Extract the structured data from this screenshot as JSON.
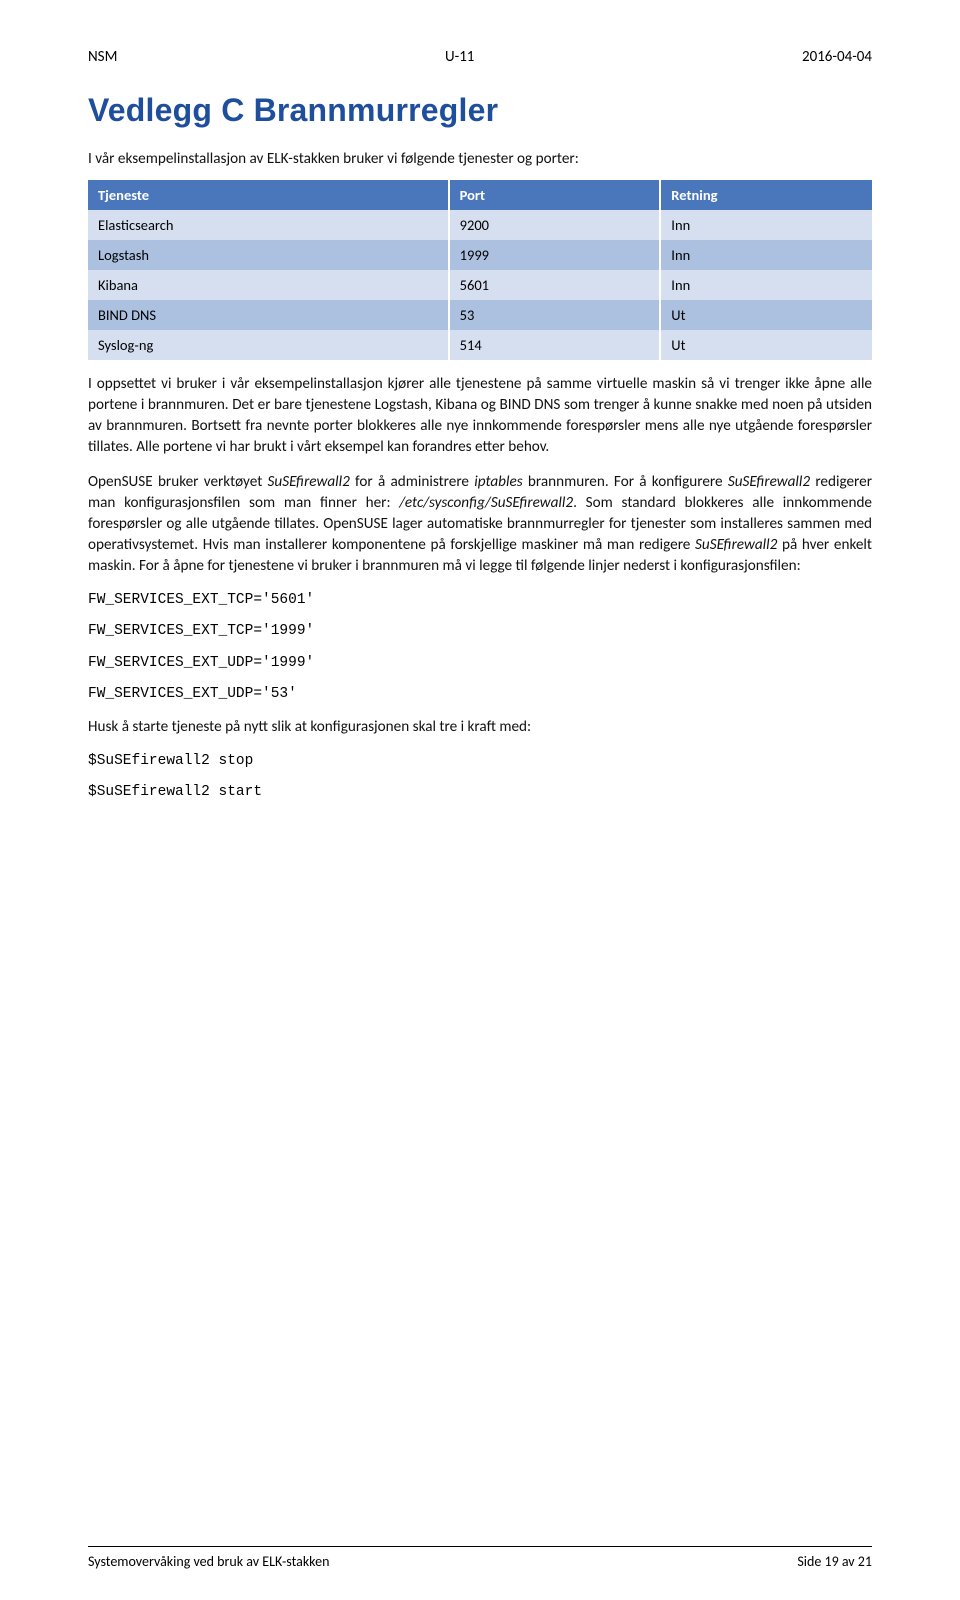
{
  "header": {
    "left": "NSM",
    "center": "U-11",
    "right": "2016-04-04"
  },
  "title": "Vedlegg C Brannmurregler",
  "intro": "I vår eksempelinstallasjon av ELK-stakken bruker vi følgende tjenester og porter:",
  "table": {
    "headers": [
      "Tjeneste",
      "Port",
      "Retning"
    ],
    "rows": [
      [
        "Elasticsearch",
        "9200",
        "Inn"
      ],
      [
        "Logstash",
        "1999",
        "Inn"
      ],
      [
        "Kibana",
        "5601",
        "Inn"
      ],
      [
        "BIND DNS",
        "53",
        "Ut"
      ],
      [
        "Syslog-ng",
        "514",
        "Ut"
      ]
    ]
  },
  "paragraphs": {
    "p1": "I oppsettet vi bruker i vår eksempelinstallasjon kjører alle tjenestene på samme virtuelle maskin så vi trenger ikke åpne alle portene i brannmuren. Det er bare tjenestene Logstash, Kibana og BIND DNS som trenger å kunne snakke med noen på utsiden av brannmuren. Bortsett fra nevnte porter blokkeres alle nye innkommende forespørsler mens alle nye utgående forespørsler tillates. Alle portene vi har brukt i vårt eksempel kan forandres etter behov.",
    "p2_pre": "OpenSUSE bruker verktøyet ",
    "p2_em1": "SuSEfirewall2",
    "p2_mid1": " for å administrere ",
    "p2_em2": "iptables",
    "p2_mid2": " brannmuren. For å konfigurere ",
    "p2_em3": "SuSEfirewall2",
    "p2_mid3": " redigerer man konfigurasjonsfilen som man finner her: ",
    "p2_em4": "/etc/sysconfig/SuSEfirewall2",
    "p2_mid4": ". Som standard blokkeres alle innkommende forespørsler og alle utgående tillates. OpenSUSE lager automatiske brannmurregler for tjenester som installeres sammen med operativsystemet. Hvis man installerer komponentene på forskjellige maskiner må man redigere ",
    "p2_em5": "SuSEfirewall2",
    "p2_mid5": " på hver enkelt maskin. For å åpne for tjenestene vi bruker i brannmuren må vi legge til følgende linjer nederst i konfigurasjonsfilen:",
    "config": {
      "l1": "FW_SERVICES_EXT_TCP='5601'",
      "l2": "FW_SERVICES_EXT_TCP='1999'",
      "l3": "FW_SERVICES_EXT_UDP='1999'",
      "l4": "FW_SERVICES_EXT_UDP='53'"
    },
    "p3": "Husk å starte tjeneste på nytt slik at konfigurasjonen skal tre i kraft med:",
    "cmds": {
      "c1": "$SuSEfirewall2 stop",
      "c2": "$SuSEfirewall2 start"
    }
  },
  "footer": {
    "left": "Systemovervåking ved bruk av ELK-stakken",
    "right": "Side 19 av 21"
  }
}
